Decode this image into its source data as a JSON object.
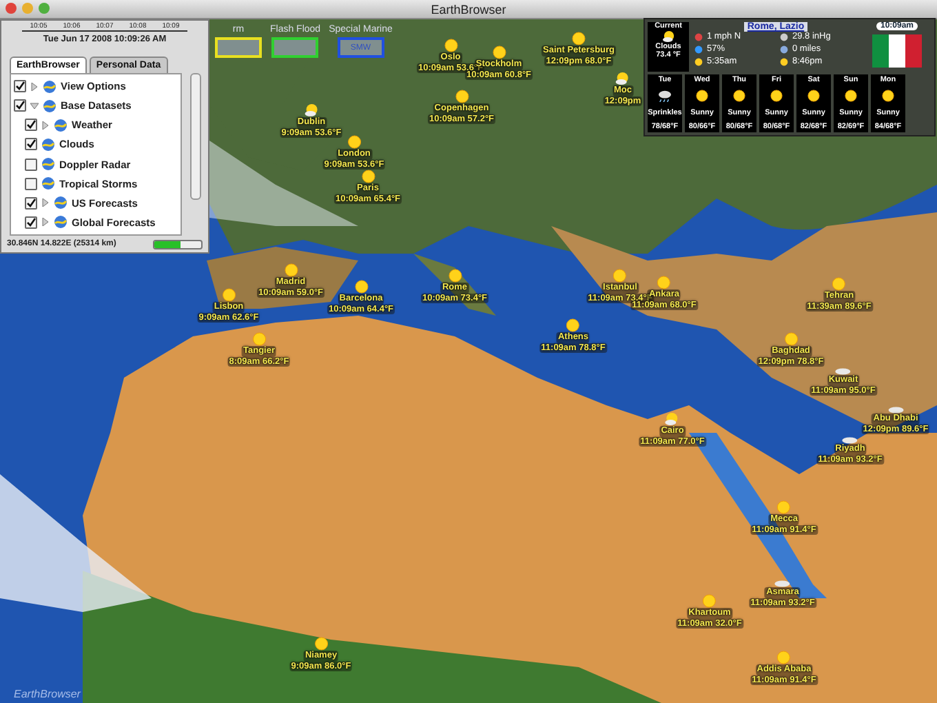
{
  "window": {
    "title": "EarthBrowser"
  },
  "layer_panel": {
    "ticks": [
      "10:05",
      "10:06",
      "10:07",
      "10:08",
      "10:09"
    ],
    "date": "Tue Jun 17 2008 10:09:26 AM",
    "tabs": [
      {
        "label": "EarthBrowser",
        "selected": true
      },
      {
        "label": "Personal Data",
        "selected": false
      }
    ],
    "layers": [
      {
        "label": "View Options",
        "checked": true,
        "expanded": false
      },
      {
        "label": "Base Datasets",
        "checked": true,
        "expanded": true,
        "children": [
          {
            "label": "Weather",
            "checked": true,
            "expanded": false
          },
          {
            "label": "Clouds",
            "checked": true
          },
          {
            "label": "Doppler Radar",
            "checked": false
          },
          {
            "label": "Tropical Storms",
            "checked": false
          },
          {
            "label": "US Forecasts",
            "checked": true,
            "expanded": false
          },
          {
            "label": "Global Forecasts",
            "checked": true,
            "expanded": false
          }
        ]
      }
    ],
    "status": "30.846N 14.822E (25314 km)",
    "progress": {
      "level": 0.55
    }
  },
  "alerts": [
    {
      "label": "rm",
      "color": "#e8e020"
    },
    {
      "label": "Flash Flood",
      "color": "#30d030"
    },
    {
      "label": "Special Marine",
      "code": "SMW",
      "color": "#2050e0"
    }
  ],
  "weather_panel": {
    "location": "Rome, Lazio",
    "clock": "10:09am",
    "current": {
      "title": "Current",
      "condition": "Clouds",
      "temp": "73.4 °F"
    },
    "readings": [
      "1 mph N",
      "29.8 inHg",
      "57%",
      "0 miles",
      "5:35am",
      "8:46pm"
    ],
    "forecast": [
      {
        "day": "Tue",
        "condition": "Sprinkles",
        "temps": "78/68°F",
        "kind": "rain"
      },
      {
        "day": "Wed",
        "condition": "Sunny",
        "temps": "80/66°F",
        "kind": "sun"
      },
      {
        "day": "Thu",
        "condition": "Sunny",
        "temps": "80/68°F",
        "kind": "sun"
      },
      {
        "day": "Fri",
        "condition": "Sunny",
        "temps": "80/68°F",
        "kind": "sun"
      },
      {
        "day": "Sat",
        "condition": "Sunny",
        "temps": "82/68°F",
        "kind": "sun"
      },
      {
        "day": "Sun",
        "condition": "Sunny",
        "temps": "82/69°F",
        "kind": "sun"
      },
      {
        "day": "Mon",
        "condition": "Sunny",
        "temps": "84/68°F",
        "kind": "sun"
      }
    ]
  },
  "cities": [
    {
      "name": "Oslo",
      "reading": "10:09am 53.6°F",
      "kind": "sun"
    },
    {
      "name": "Stockholm",
      "reading": "10:09am 60.8°F",
      "kind": "sun"
    },
    {
      "name": "Saint Petersburg",
      "reading": "12:09pm 68.0°F",
      "kind": "sun"
    },
    {
      "name": "Moc",
      "reading": "12:09pm",
      "kind": "partly"
    },
    {
      "name": "Copenhagen",
      "reading": "10:09am 57.2°F",
      "kind": "sun"
    },
    {
      "name": "Dublin",
      "reading": "9:09am 53.6°F",
      "kind": "partly"
    },
    {
      "name": "London",
      "reading": "9:09am 53.6°F",
      "kind": "sun"
    },
    {
      "name": "Paris",
      "reading": "10:09am 65.4°F",
      "kind": "sun"
    },
    {
      "name": "Madrid",
      "reading": "10:09am 59.0°F",
      "kind": "sun"
    },
    {
      "name": "Barcelona",
      "reading": "10:09am 64.4°F",
      "kind": "sun"
    },
    {
      "name": "Lisbon",
      "reading": "9:09am 62.6°F",
      "kind": "sun"
    },
    {
      "name": "Tangier",
      "reading": "8:09am 66.2°F",
      "kind": "sun"
    },
    {
      "name": "Rome",
      "reading": "10:09am 73.4°F",
      "kind": "sun"
    },
    {
      "name": "Istanbul",
      "reading": "11:09am 73.4°F",
      "kind": "sun"
    },
    {
      "name": "Ankara",
      "reading": "11:09am 68.0°F",
      "kind": "sun"
    },
    {
      "name": "Athens",
      "reading": "11:09am 78.8°F",
      "kind": "sun"
    },
    {
      "name": "Tehran",
      "reading": "11:39am 89.6°F",
      "kind": "sun"
    },
    {
      "name": "Baghdad",
      "reading": "12:09pm 78.8°F",
      "kind": "sun"
    },
    {
      "name": "Kuwait",
      "reading": "11:09am 95.0°F",
      "kind": "cloud"
    },
    {
      "name": "Abu Dhabi",
      "reading": "12:09pm 89.6°F",
      "kind": "cloud"
    },
    {
      "name": "Riyadh",
      "reading": "11:09am 93.2°F",
      "kind": "cloud"
    },
    {
      "name": "Cairo",
      "reading": "11:09am 77.0°F",
      "kind": "partly"
    },
    {
      "name": "Mecca",
      "reading": "11:09am 91.4°F",
      "kind": "sun"
    },
    {
      "name": "Asmara",
      "reading": "11:09am 93.2°F",
      "kind": "cloud"
    },
    {
      "name": "Khartoum",
      "reading": "11:09am 32.0°F",
      "kind": "sun"
    },
    {
      "name": "Addis Ababa",
      "reading": "11:09am 91.4°F",
      "kind": "sun"
    },
    {
      "name": "Niamey",
      "reading": "9:09am 86.0°F",
      "kind": "sun"
    }
  ],
  "logo": "EarthBrowser"
}
